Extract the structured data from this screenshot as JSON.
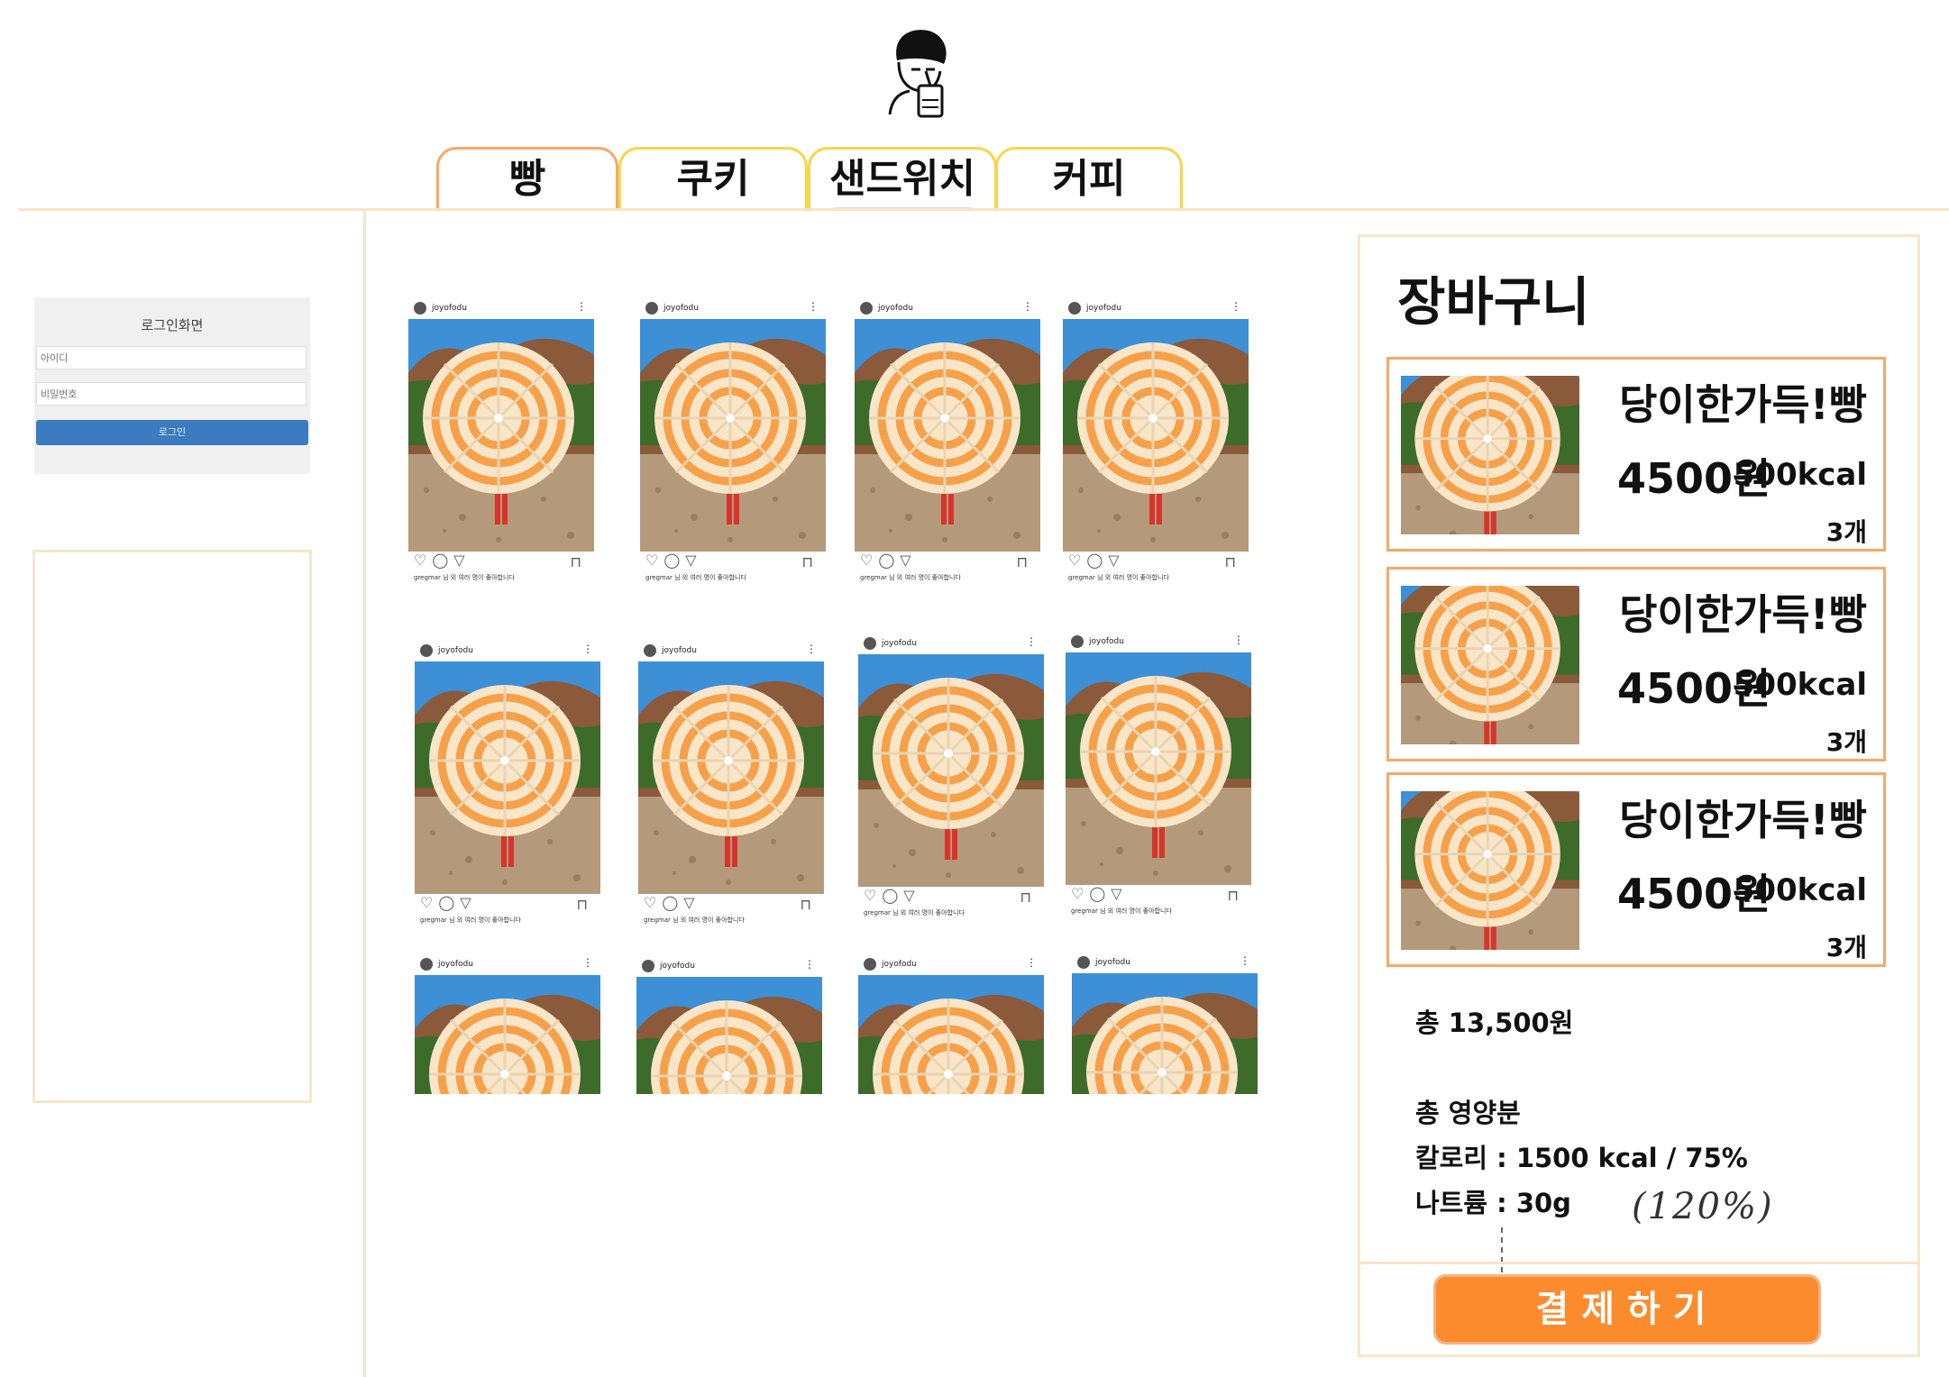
{
  "logo": {
    "icon": "person-drinking-icon"
  },
  "tabs": [
    {
      "label": "빵"
    },
    {
      "label": "쿠키"
    },
    {
      "label": "샌드위치"
    },
    {
      "label": "커피"
    }
  ],
  "login": {
    "title": "로그인화면",
    "id_placeholder": "아이디",
    "pw_placeholder": "비밀번호",
    "button": "로그인"
  },
  "feed": {
    "username": "joyofodu",
    "likes_text": "gregmar 님 외 여러 명이 좋아합니다"
  },
  "cart": {
    "title": "장바구니",
    "items": [
      {
        "name": "당이한가득!빵",
        "price": "4500원",
        "kcal": "500kcal",
        "qty": "3개"
      },
      {
        "name": "당이한가득!빵",
        "price": "4500원",
        "kcal": "500kcal",
        "qty": "3개"
      },
      {
        "name": "당이한가득!빵",
        "price": "4500원",
        "kcal": "500kcal",
        "qty": "3개"
      }
    ],
    "total": "총 13,500원",
    "nutrition_title": "총 영양분",
    "calories": "칼로리 : 1500 kcal / 75%",
    "sodium": "나트륨 : 30g",
    "handwritten_note": "(120%)",
    "pay_button": "결제하기"
  },
  "colors": {
    "tab_active_border": "#f6a868",
    "tab_border": "#f7d64a",
    "item_border": "#f6a868",
    "pay_button": "#fb8b2c",
    "frame_line": "#f6e7c8",
    "login_button": "#3b7bbf"
  }
}
